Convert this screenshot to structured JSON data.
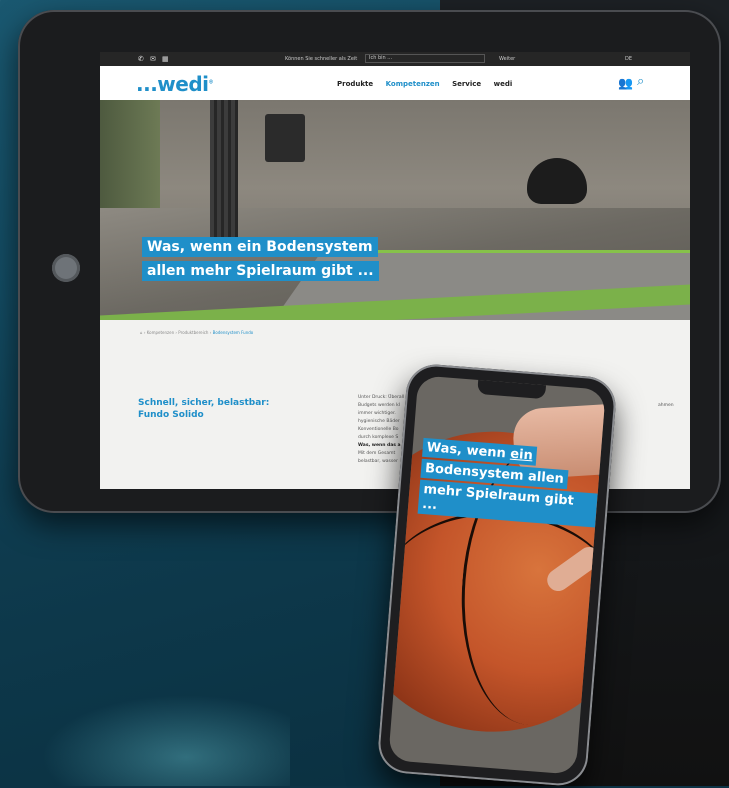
{
  "tablet": {
    "topbar": {
      "prompt": "Können Sie schneller als Zeit",
      "select_value": "Ich bin ...",
      "weiter": "Weiter",
      "lang": "DE"
    },
    "logo": "...wedi",
    "menu": [
      "Produkte",
      "Kompetenzen",
      "Service",
      "wedi"
    ],
    "menu_active_index": 1,
    "hero_title_lines": [
      "Was, wenn ein Bodensystem",
      "allen mehr Spielraum gibt ..."
    ],
    "breadcrumb": [
      "Kompetenzen",
      "Produktbereich",
      "Bodensystem Fundo"
    ],
    "subheading_lines": [
      "Schnell, sicher, belastbar:",
      "Fundo Solido"
    ],
    "body_lines": [
      "Unter Druck: Überall",
      "Budgets werden kl",
      "immer wichtiger.",
      "hygienische Bäder",
      "Konventionelle Bo",
      "durch komplexe S",
      "Was, wenn das a",
      "Mit dem Gesamt",
      "belastbar, wasser"
    ],
    "body_trailing": "ahmen"
  },
  "phone": {
    "title_lines": [
      "Was, wenn ein",
      "Bodensystem allen",
      "mehr Spielraum gibt ..."
    ],
    "underlined_word": "ein"
  },
  "colors": {
    "brand_blue": "#1f8fc9",
    "topbar": "#262626",
    "background_teal": "#134b62"
  },
  "icons": [
    "phone-icon",
    "mail-icon",
    "calendar-icon",
    "people-icon",
    "search-icon"
  ]
}
